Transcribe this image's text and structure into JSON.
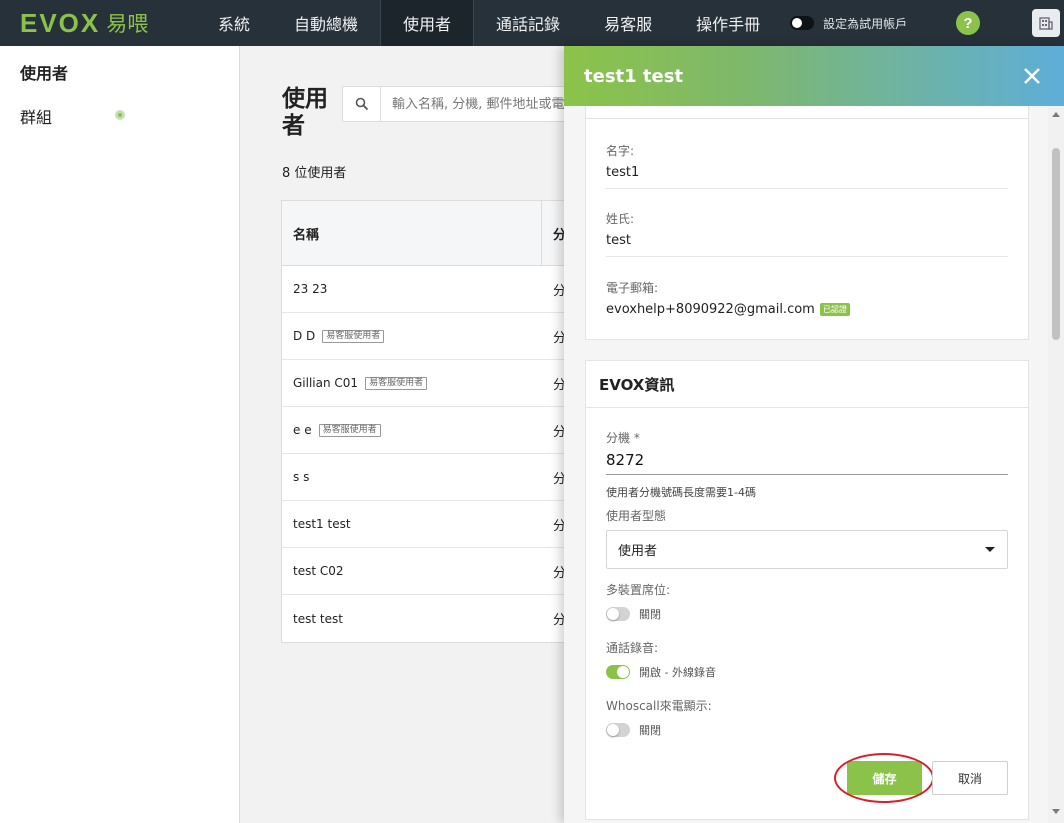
{
  "brand": {
    "logo_text": "EVOX",
    "logo_sub": "易喂"
  },
  "nav": {
    "items": [
      {
        "label": "系統",
        "active": false
      },
      {
        "label": "自動總機",
        "active": false
      },
      {
        "label": "使用者",
        "active": true
      },
      {
        "label": "通話記錄",
        "active": false
      },
      {
        "label": "易客服",
        "active": false
      },
      {
        "label": "操作手冊",
        "active": false
      }
    ],
    "trial_label": "設定為試用帳戶",
    "help_icon_text": "?"
  },
  "sidebar": {
    "items": [
      {
        "label": "使用者",
        "active": true
      },
      {
        "label": "群組",
        "active": false
      }
    ]
  },
  "main": {
    "title": "使用者",
    "search_placeholder": "輸入名稱, 分機, 郵件地址或電",
    "user_count": "8 位使用者",
    "table": {
      "headers": [
        "名稱",
        "分"
      ],
      "rows": [
        {
          "name": "23 23",
          "badge": "",
          "ext": "分"
        },
        {
          "name": "D D",
          "badge": "易客服使用者",
          "ext": "分"
        },
        {
          "name": "Gillian C01",
          "badge": "易客服使用者",
          "ext": "分"
        },
        {
          "name": "e e",
          "badge": "易客服使用者",
          "ext": "分"
        },
        {
          "name": "s s",
          "badge": "",
          "ext": "分"
        },
        {
          "name": "test1 test",
          "badge": "",
          "ext": "分"
        },
        {
          "name": "test C02",
          "badge": "",
          "ext": "分"
        },
        {
          "name": "test test",
          "badge": "",
          "ext": "分"
        }
      ]
    }
  },
  "drawer": {
    "title": "test1 test",
    "basic": {
      "first_name_label": "名字:",
      "first_name": "test1",
      "last_name_label": "姓氏:",
      "last_name": "test",
      "email_label": "電子郵箱:",
      "email": "evoxhelp+8090922@gmail.com",
      "verified_badge": "已認證"
    },
    "evox": {
      "section_title": "EVOX資訊",
      "ext_label": "分機 *",
      "ext_value": "8272",
      "ext_hint": "使用者分機號碼長度需要1-4碼",
      "user_type_label": "使用者型態",
      "user_type_value": "使用者",
      "multi_device_label": "多裝置席位:",
      "multi_device_state": "關閉",
      "recording_label": "通話錄音:",
      "recording_state": "開啟 - 外線錄音",
      "whoscall_label": "Whoscall來電顯示:",
      "whoscall_state": "關閉"
    },
    "save_label": "儲存",
    "cancel_label": "取消"
  },
  "colors": {
    "brand_green": "#8bc34a",
    "topbar": "#27313a",
    "header_gradient_end": "#5eaed9",
    "highlight_ring": "#d8202a"
  }
}
